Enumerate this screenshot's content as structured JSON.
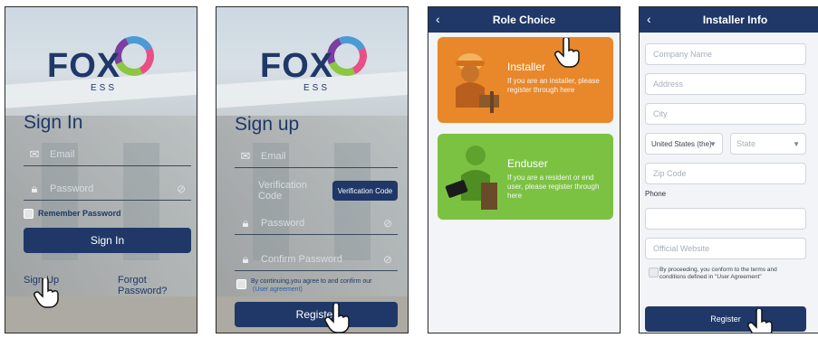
{
  "screen1": {
    "brand": "FOX",
    "brand_sub": "ESS",
    "title": "Sign In",
    "email_placeholder": "Email",
    "password_placeholder": "Password",
    "remember_label": "Remember Password",
    "sign_in_button": "Sign In",
    "sign_up_link": "Sign Up",
    "forgot_link": "Forgot Password?"
  },
  "screen2": {
    "brand": "FOX",
    "brand_sub": "ESS",
    "title": "Sign up",
    "email_placeholder": "Email",
    "verification_placeholder": "Verification Code",
    "verification_button": "Verification Code",
    "password_placeholder": "Password",
    "confirm_placeholder": "Confirm Password",
    "agree_text": "By continuing,you agree to and confirm our",
    "agree_link": "(User agreement)",
    "register_button": "Register"
  },
  "screen3": {
    "title": "Role Choice",
    "installer": {
      "title": "Installer",
      "desc": "If you are an installer, please register through here",
      "color": "#e8882a"
    },
    "enduser": {
      "title": "Enduser",
      "desc": "If you are a resident or end user, please register through here",
      "color": "#7cc242"
    }
  },
  "screen4": {
    "title": "Installer Info",
    "company_placeholder": "Company Name",
    "address_placeholder": "Address",
    "city_placeholder": "City",
    "country_value": "United States (the)",
    "state_placeholder": "State",
    "zip_placeholder": "Zip Code",
    "phone_label": "Phone",
    "website_placeholder": "Official Website",
    "terms_text": "By proceeding, you conform to the terms and conditions defined in \"User Agreement\"",
    "register_button": "Register"
  },
  "colors": {
    "navy": "#1f3867",
    "installer_orange": "#e8882a",
    "enduser_green": "#7cc242",
    "light_bg": "#f2f4f7"
  }
}
